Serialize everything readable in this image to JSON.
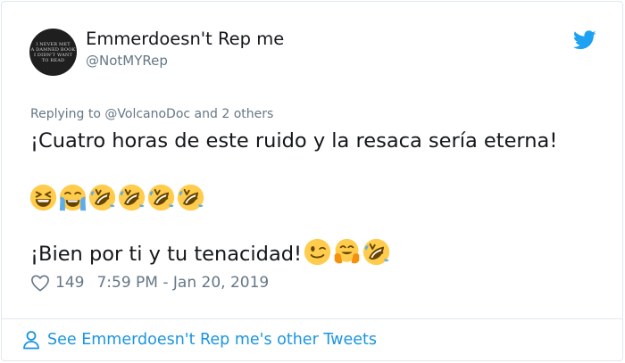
{
  "tweet": {
    "avatar_lines": [
      "I NEVER MET",
      "A DAMNED BOOK",
      "I DIDN'T WANT",
      "TO READ"
    ],
    "display_name": "Emmerdoesn't Rep me",
    "handle": "@NotMYRep",
    "replying_prefix": "Replying to ",
    "replying_mention": "@VolcanoDoc",
    "replying_suffix": " and 2 others",
    "line1": "¡Cuatro horas de este ruido y la resaca sería eterna!",
    "line3": "¡Bien por ti y tu tenacidad!",
    "emojis_line2": [
      "grinning-squinting",
      "loudly-crying",
      "rolling-laughing",
      "rolling-laughing",
      "rolling-laughing",
      "rolling-laughing"
    ],
    "emojis_line3": [
      "winking",
      "hugging",
      "rolling-laughing"
    ],
    "likes": "149",
    "timestamp": "7:59 PM - Jan 20, 2019"
  },
  "footer": {
    "link_text": "See Emmerdoesn't Rep me's other Tweets"
  },
  "colors": {
    "twitter_blue": "#1da1f2",
    "link_blue": "#1b95e0",
    "gray": "#657786",
    "text": "#14171a",
    "border": "#e1e8ed"
  }
}
